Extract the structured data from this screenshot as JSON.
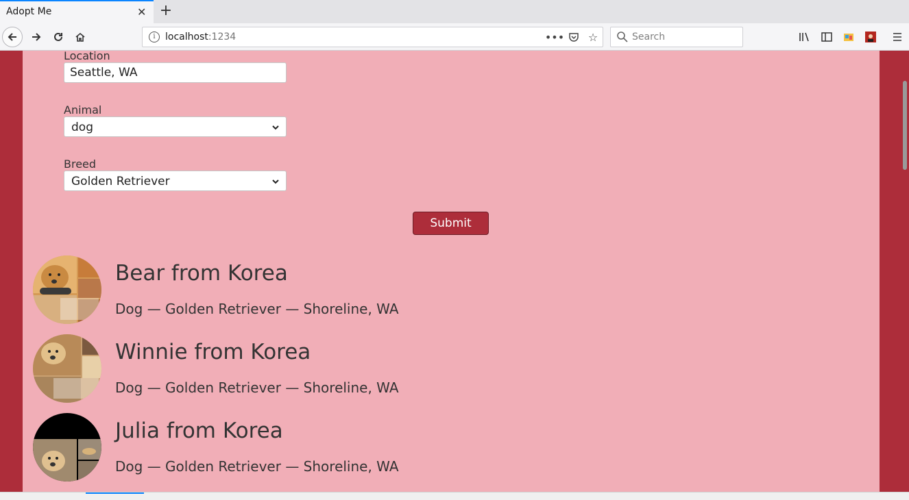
{
  "browser": {
    "tab_title": "Adopt Me",
    "url_host": "localhost",
    "url_port": ":1234",
    "search_placeholder": "Search"
  },
  "form": {
    "location": {
      "label": "Location",
      "value": "Seattle, WA"
    },
    "animal": {
      "label": "Animal",
      "value": "dog"
    },
    "breed": {
      "label": "Breed",
      "value": "Golden Retriever"
    },
    "submit_label": "Submit"
  },
  "pets": [
    {
      "name": "Bear from Korea",
      "info": "Dog — Golden Retriever — Shoreline, WA"
    },
    {
      "name": "Winnie from Korea",
      "info": "Dog — Golden Retriever — Shoreline, WA"
    },
    {
      "name": "Julia from Korea",
      "info": "Dog — Golden Retriever — Shoreline, WA"
    }
  ],
  "colors": {
    "page_bg": "#f1aeb7",
    "frame_bg": "#ad2d3a",
    "button_bg": "#ad2d3a"
  }
}
